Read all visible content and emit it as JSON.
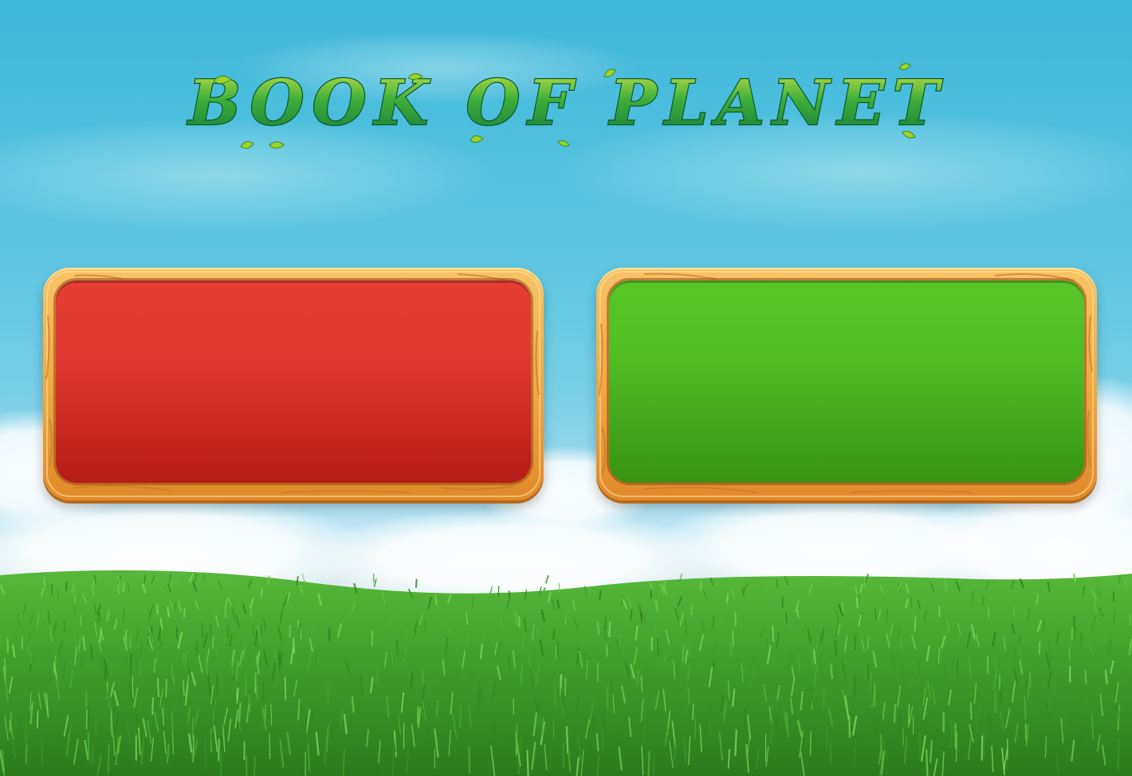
{
  "game": {
    "title": "BOOK OF PLANET"
  },
  "buttons": {
    "left_label": "",
    "right_label": ""
  },
  "colors": {
    "sky_top": "#3fb7d9",
    "sky_horizon": "#dcecf0",
    "grass": "#3f9a2a",
    "wood_frame": "#f0a844",
    "left_panel": "#e03a31",
    "right_panel": "#53be22",
    "title_green": "#2e9a35",
    "title_leaf": "#a8d62a"
  }
}
